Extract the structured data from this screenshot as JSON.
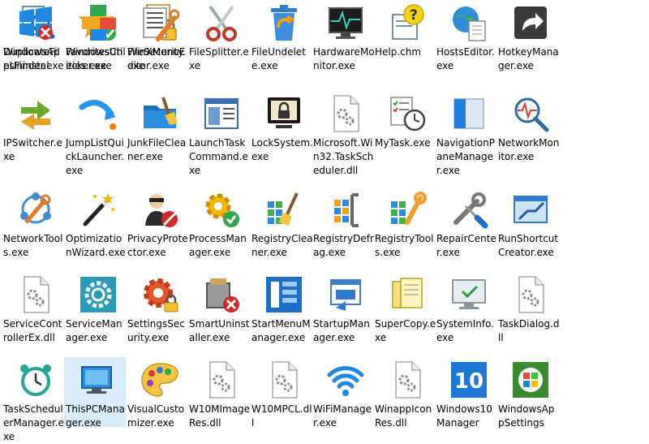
{
  "files": [
    {
      "label": "DuplicateFilesFinder.exe",
      "icon": "magnifier-doc-icon"
    },
    {
      "label": "FavoritesChecker.exe",
      "icon": "star-check-icon"
    },
    {
      "label": "FileSecurity.exe",
      "icon": "doc-lock-icon"
    },
    {
      "label": "FileSplitter.exe",
      "icon": "scissors-icon"
    },
    {
      "label": "FileUndelete.exe",
      "icon": "recycle-bin-icon"
    },
    {
      "label": "HardwareMonitor.exe",
      "icon": "monitor-pulse-icon"
    },
    {
      "label": "Help.chm",
      "icon": "help-question-icon"
    },
    {
      "label": "HostsEditor.exe",
      "icon": "globe-doc-icon"
    },
    {
      "label": "HotkeyManager.exe",
      "icon": "shortcut-arrow-icon"
    },
    {
      "label": "IPSwitcher.exe",
      "icon": "switch-arrows-icon"
    },
    {
      "label": "JumpListQuickLauncher.exe",
      "icon": "jump-arrow-icon"
    },
    {
      "label": "JunkFileCleaner.exe",
      "icon": "folder-broom-icon"
    },
    {
      "label": "LaunchTaskCommand.exe",
      "icon": "window-list-icon"
    },
    {
      "label": "LockSystem.exe",
      "icon": "lock-screen-icon"
    },
    {
      "label": "Microsoft.Win32.TaskScheduler.dll",
      "icon": "dll-gear-file-icon"
    },
    {
      "label": "MyTask.exe",
      "icon": "checklist-clock-icon"
    },
    {
      "label": "NavigationPaneManager.exe",
      "icon": "nav-pane-icon"
    },
    {
      "label": "NetworkMonitor.exe",
      "icon": "network-monitor-icon"
    },
    {
      "label": "NetworkTools.exe",
      "icon": "network-tools-icon"
    },
    {
      "label": "OptimizationWizard.exe",
      "icon": "magic-wand-icon"
    },
    {
      "label": "PrivacyProtector.exe",
      "icon": "privacy-person-icon"
    },
    {
      "label": "ProcessManager.exe",
      "icon": "gear-check-icon"
    },
    {
      "label": "RegistryCleaner.exe",
      "icon": "registry-broom-icon"
    },
    {
      "label": "RegistryDefrag.exe",
      "icon": "registry-clamp-icon"
    },
    {
      "label": "RegistryTools.exe",
      "icon": "registry-wrench-icon"
    },
    {
      "label": "RepairCenter.exe",
      "icon": "wrench-screwdriver-icon"
    },
    {
      "label": "RunShortcutCreator.exe",
      "icon": "run-window-icon"
    },
    {
      "label": "ServiceControllerEx.dll",
      "icon": "dll-gear-file-icon"
    },
    {
      "label": "ServiceManager.exe",
      "icon": "service-gear-icon"
    },
    {
      "label": "SettingsSecurity.exe",
      "icon": "gear-lock-icon"
    },
    {
      "label": "SmartUninstaller.exe",
      "icon": "uninstall-box-icon"
    },
    {
      "label": "StartMenuManager.exe",
      "icon": "start-menu-icon"
    },
    {
      "label": "StartupManager.exe",
      "icon": "startup-window-icon"
    },
    {
      "label": "SuperCopy.exe",
      "icon": "copy-docs-icon"
    },
    {
      "label": "SystemInfo.exe",
      "icon": "monitor-check-icon"
    },
    {
      "label": "TaskDialog.dll",
      "icon": "dll-gear-file-icon"
    },
    {
      "label": "TaskSchedulerManager.exe",
      "icon": "alarm-clock-icon"
    },
    {
      "label": "ThisPCManager.exe",
      "icon": "this-pc-icon"
    },
    {
      "label": "VisualCustomizer.exe",
      "icon": "palette-icon"
    },
    {
      "label": "W10MImageRes.dll",
      "icon": "dll-gear-file-icon"
    },
    {
      "label": "W10MPCL.dll",
      "icon": "dll-gear-file-icon"
    },
    {
      "label": "WiFiManager.exe",
      "icon": "wifi-icon"
    },
    {
      "label": "WinappIconRes.dll",
      "icon": "dll-gear-file-icon"
    },
    {
      "label": "Windows10Manager",
      "icon": "windows10-logo-icon"
    },
    {
      "label": "WindowsAppSettings",
      "icon": "xp-logo-icon"
    },
    {
      "label": "WindowsAppUninstal",
      "icon": "windows-uninstall-icon"
    },
    {
      "label": "WindowsUtilities.exe",
      "icon": "colored-blocks-icon"
    },
    {
      "label": "WinXMenuEditor.exe",
      "icon": "winx-wrench-icon"
    }
  ],
  "selected_index": 37
}
